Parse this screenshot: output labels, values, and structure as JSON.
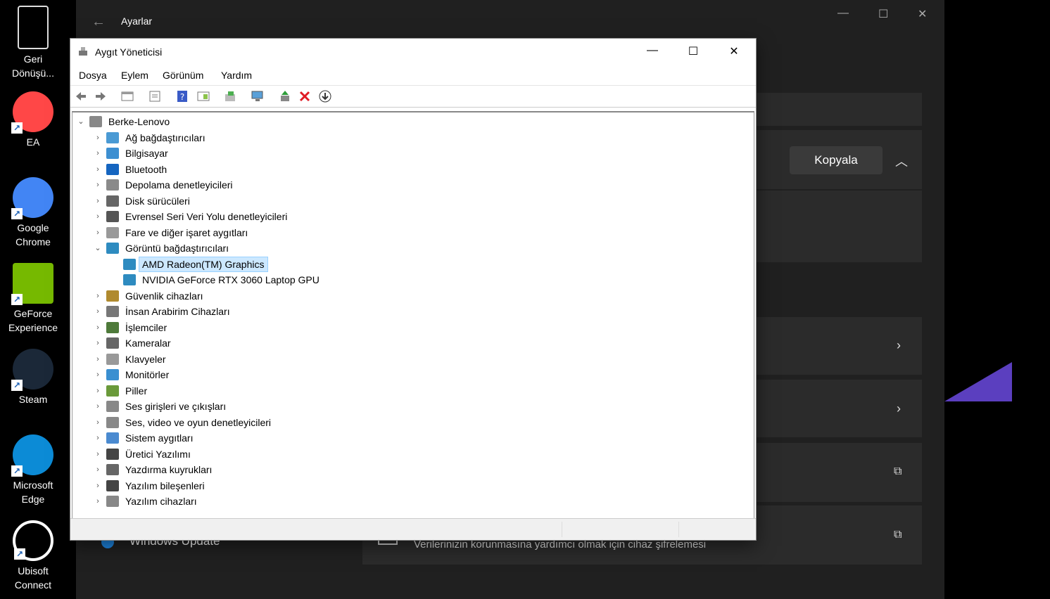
{
  "desktop": {
    "icons": [
      {
        "label": "Geri Dönüşü...",
        "icon": "recycle-bin-icon",
        "color": "#e8e8e8"
      },
      {
        "label": "EA",
        "icon": "ea-icon",
        "color": "#ff4747"
      },
      {
        "label": "Google Chrome",
        "icon": "chrome-icon",
        "color": "#4285f4"
      },
      {
        "label": "GeForce Experience",
        "icon": "geforce-icon",
        "color": "#76b900"
      },
      {
        "label": "Steam",
        "icon": "steam-icon",
        "color": "#1b2838"
      },
      {
        "label": "Microsoft Edge",
        "icon": "edge-icon",
        "color": "#0c8bd6"
      },
      {
        "label": "Ubisoft Connect",
        "icon": "ubisoft-icon",
        "color": "#ffffff"
      }
    ]
  },
  "settings": {
    "title": "Ayarlar",
    "copy_button": "Kopyala",
    "windows_update": "Windows Update",
    "encryption_text": "Verilerinizin korunmasına yardımcı olmak için cihaz şifrelemesi"
  },
  "device_manager": {
    "title": "Aygıt Yöneticisi",
    "menu": [
      "Dosya",
      "Eylem",
      "Görünüm",
      "Yardım"
    ],
    "root": "Berke-Lenovo",
    "categories": [
      {
        "label": "Ağ bağdaştırıcıları",
        "icon": "network-adapter-icon",
        "expanded": false
      },
      {
        "label": "Bilgisayar",
        "icon": "computer-icon",
        "expanded": false
      },
      {
        "label": "Bluetooth",
        "icon": "bluetooth-icon",
        "expanded": false
      },
      {
        "label": "Depolama denetleyicileri",
        "icon": "storage-controller-icon",
        "expanded": false
      },
      {
        "label": "Disk sürücüleri",
        "icon": "disk-drive-icon",
        "expanded": false
      },
      {
        "label": "Evrensel Seri Veri Yolu denetleyicileri",
        "icon": "usb-icon",
        "expanded": false
      },
      {
        "label": "Fare ve diğer işaret aygıtları",
        "icon": "mouse-icon",
        "expanded": false
      },
      {
        "label": "Görüntü bağdaştırıcıları",
        "icon": "display-adapter-icon",
        "expanded": true,
        "children": [
          {
            "label": "AMD Radeon(TM) Graphics",
            "selected": true
          },
          {
            "label": "NVIDIA GeForce RTX 3060 Laptop GPU",
            "selected": false
          }
        ]
      },
      {
        "label": "Güvenlik cihazları",
        "icon": "security-device-icon",
        "expanded": false
      },
      {
        "label": "İnsan Arabirim Cihazları",
        "icon": "hid-icon",
        "expanded": false
      },
      {
        "label": "İşlemciler",
        "icon": "processor-icon",
        "expanded": false
      },
      {
        "label": "Kameralar",
        "icon": "camera-icon",
        "expanded": false
      },
      {
        "label": "Klavyeler",
        "icon": "keyboard-icon",
        "expanded": false
      },
      {
        "label": "Monitörler",
        "icon": "monitor-icon",
        "expanded": false
      },
      {
        "label": "Piller",
        "icon": "battery-icon",
        "expanded": false
      },
      {
        "label": "Ses girişleri ve çıkışları",
        "icon": "audio-io-icon",
        "expanded": false
      },
      {
        "label": "Ses, video ve oyun denetleyicileri",
        "icon": "sound-controller-icon",
        "expanded": false
      },
      {
        "label": "Sistem aygıtları",
        "icon": "system-device-icon",
        "expanded": false
      },
      {
        "label": "Üretici Yazılımı",
        "icon": "firmware-icon",
        "expanded": false
      },
      {
        "label": "Yazdırma kuyrukları",
        "icon": "print-queue-icon",
        "expanded": false
      },
      {
        "label": "Yazılım bileşenleri",
        "icon": "software-component-icon",
        "expanded": false
      },
      {
        "label": "Yazılım cihazları",
        "icon": "software-device-icon",
        "expanded": false
      }
    ],
    "toolbar": [
      "back-icon",
      "forward-icon",
      "show-hide-tree-icon",
      "properties-icon",
      "help-icon",
      "view-icon",
      "update-driver-icon",
      "scan-hardware-icon",
      "add-driver-icon",
      "uninstall-icon",
      "disable-icon"
    ]
  }
}
